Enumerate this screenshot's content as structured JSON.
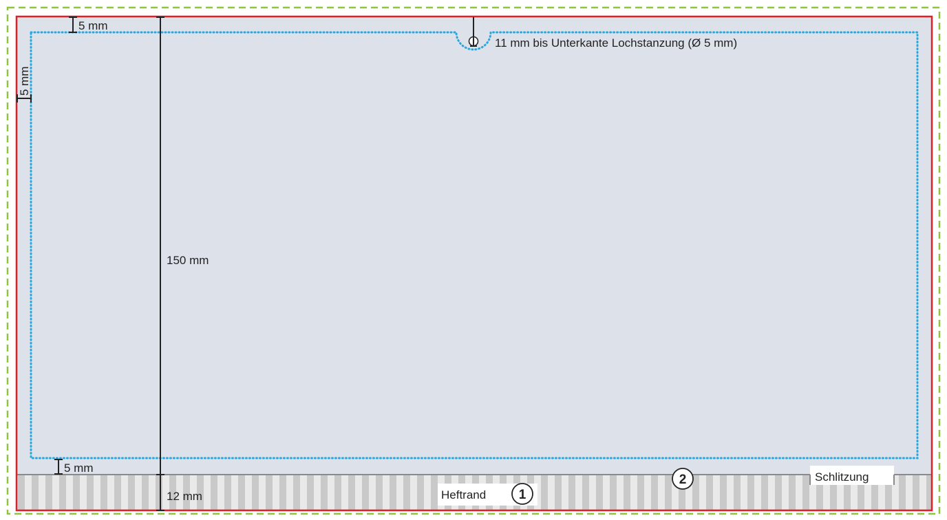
{
  "dimensions": {
    "top_margin": "5 mm",
    "left_margin": "5 mm",
    "bottom_margin": "5 mm",
    "height": "150 mm",
    "hole_distance": "11 mm bis Unterkante Lochstanzung (Ø 5 mm)",
    "binding_height": "12 mm"
  },
  "labels": {
    "heftrand": "Heftrand",
    "schlitzung": "Schlitzung"
  },
  "markers": {
    "one": "1",
    "two": "2"
  },
  "colors": {
    "bleed_line": "#8cc63f",
    "trim_line": "#e31e24",
    "safe_line": "#29a8e0",
    "card_fill": "#dde1e9",
    "stripe": "#c8c8c8",
    "dimension": "#222222"
  }
}
